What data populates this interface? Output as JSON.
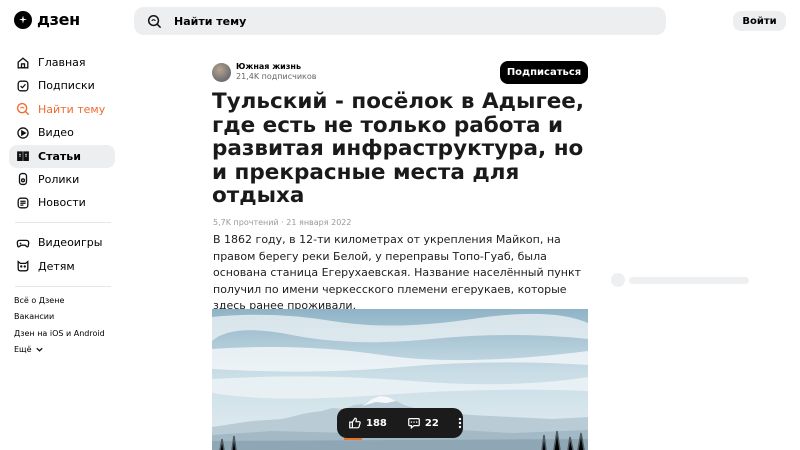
{
  "header": {
    "logo_text": "дзен",
    "search_text": "Найти тему",
    "login_label": "Войти"
  },
  "sidebar": {
    "items": [
      {
        "label": "Главная",
        "icon": "home-icon"
      },
      {
        "label": "Подписки",
        "icon": "subscriptions-icon"
      },
      {
        "label": "Найти тему",
        "icon": "search-icon"
      },
      {
        "label": "Видео",
        "icon": "video-icon"
      },
      {
        "label": "Статьи",
        "icon": "articles-icon"
      },
      {
        "label": "Ролики",
        "icon": "shorts-icon"
      },
      {
        "label": "Новости",
        "icon": "news-icon"
      }
    ],
    "extra": [
      {
        "label": "Видеоигры",
        "icon": "gamepad-icon"
      },
      {
        "label": "Детям",
        "icon": "kids-icon"
      }
    ],
    "footer": [
      "Всё о Дзене",
      "Вакансии",
      "Дзен на iOS и Android",
      "Ещё"
    ]
  },
  "article": {
    "channel_name": "Южная жизнь",
    "channel_subs": "21,4K подписчиков",
    "subscribe_label": "Подписаться",
    "title": "Тульский - посёлок в Адыгее, где есть не только работа и развитая инфраструктура, но и прекрасные места для отдыха",
    "meta": "5,7K прочтений · 21 января 2022",
    "lead": "В 1862 году, в 12-ти километрах от укрепления Майкоп, на правом берегу реки Белой, у переправы Топо-Гуаб, была основана станица Егерухаевская. Название населённый пункт получил по имени черкесского племени егерукаев, которые здесь ранее проживали."
  },
  "actions": {
    "likes": "188",
    "comments": "22"
  },
  "colors": {
    "accent": "#f26a2e",
    "chip_bg": "#edeef0",
    "dark": "#1b1b1b"
  }
}
